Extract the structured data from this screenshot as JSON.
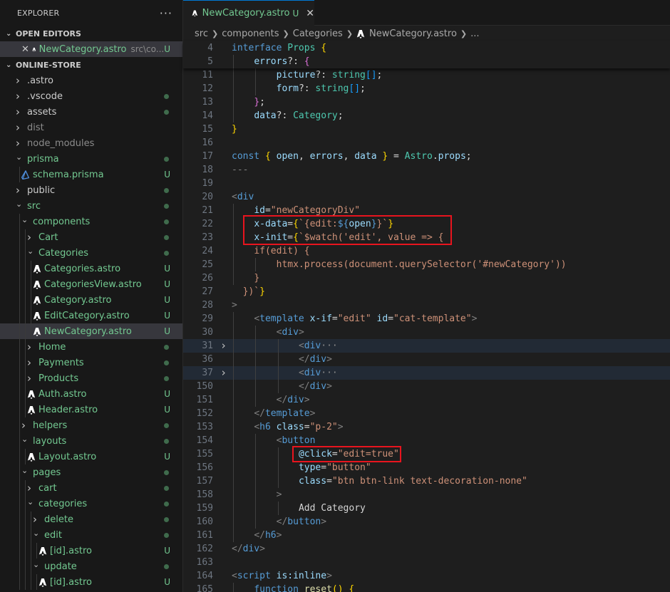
{
  "sidebar": {
    "title": "EXPLORER",
    "more_label": "···",
    "open_editors_title": "OPEN EDITORS",
    "open_editor": {
      "name": "NewCategory.astro",
      "path": "src\\co...",
      "status": "U"
    },
    "project_title": "ONLINE-STORE",
    "tree": [
      {
        "label": ".astro",
        "depth": 0,
        "chev": ">",
        "kind": "folder",
        "color": "norm"
      },
      {
        "label": ".vscode",
        "depth": 0,
        "chev": ">",
        "kind": "folder",
        "color": "norm",
        "dot": true
      },
      {
        "label": "assets",
        "depth": 0,
        "chev": ">",
        "kind": "folder",
        "color": "norm",
        "dot": true
      },
      {
        "label": "dist",
        "depth": 0,
        "chev": ">",
        "kind": "folder",
        "color": "dim"
      },
      {
        "label": "node_modules",
        "depth": 0,
        "chev": ">",
        "kind": "folder",
        "color": "dim"
      },
      {
        "label": "prisma",
        "depth": 0,
        "chev": "v",
        "kind": "folder",
        "color": "git",
        "dot": true
      },
      {
        "label": "schema.prisma",
        "depth": 1,
        "kind": "prisma",
        "color": "git",
        "status": "U"
      },
      {
        "label": "public",
        "depth": 0,
        "chev": ">",
        "kind": "folder",
        "color": "norm",
        "dot": true
      },
      {
        "label": "src",
        "depth": 0,
        "chev": "v",
        "kind": "folder",
        "color": "git",
        "dot": true
      },
      {
        "label": "components",
        "depth": 1,
        "chev": "v",
        "kind": "folder",
        "color": "git",
        "dot": true
      },
      {
        "label": "Cart",
        "depth": 2,
        "chev": ">",
        "kind": "folder",
        "color": "git",
        "dot": true
      },
      {
        "label": "Categories",
        "depth": 2,
        "chev": "v",
        "kind": "folder",
        "color": "git",
        "dot": true
      },
      {
        "label": "Categories.astro",
        "depth": 3,
        "kind": "astro",
        "color": "git",
        "status": "U"
      },
      {
        "label": "CategoriesView.astro",
        "depth": 3,
        "kind": "astro",
        "color": "git",
        "status": "U"
      },
      {
        "label": "Category.astro",
        "depth": 3,
        "kind": "astro",
        "color": "git",
        "status": "U"
      },
      {
        "label": "EditCategory.astro",
        "depth": 3,
        "kind": "astro",
        "color": "git",
        "status": "U"
      },
      {
        "label": "NewCategory.astro",
        "depth": 3,
        "kind": "astro",
        "color": "git",
        "status": "U",
        "selected": true
      },
      {
        "label": "Home",
        "depth": 2,
        "chev": ">",
        "kind": "folder",
        "color": "git",
        "dot": true
      },
      {
        "label": "Payments",
        "depth": 2,
        "chev": ">",
        "kind": "folder",
        "color": "git",
        "dot": true
      },
      {
        "label": "Products",
        "depth": 2,
        "chev": ">",
        "kind": "folder",
        "color": "git",
        "dot": true
      },
      {
        "label": "Auth.astro",
        "depth": 2,
        "kind": "astro",
        "color": "git",
        "status": "U"
      },
      {
        "label": "Header.astro",
        "depth": 2,
        "kind": "astro",
        "color": "git",
        "status": "U"
      },
      {
        "label": "helpers",
        "depth": 1,
        "chev": ">",
        "kind": "folder",
        "color": "git",
        "dot": true
      },
      {
        "label": "layouts",
        "depth": 1,
        "chev": "v",
        "kind": "folder",
        "color": "git",
        "dot": true
      },
      {
        "label": "Layout.astro",
        "depth": 2,
        "kind": "astro",
        "color": "git",
        "status": "U"
      },
      {
        "label": "pages",
        "depth": 1,
        "chev": "v",
        "kind": "folder",
        "color": "git",
        "dot": true
      },
      {
        "label": "cart",
        "depth": 2,
        "chev": ">",
        "kind": "folder",
        "color": "git",
        "dot": true
      },
      {
        "label": "categories",
        "depth": 2,
        "chev": "v",
        "kind": "folder",
        "color": "git",
        "dot": true
      },
      {
        "label": "delete",
        "depth": 3,
        "chev": ">",
        "kind": "folder",
        "color": "git",
        "dot": true
      },
      {
        "label": "edit",
        "depth": 3,
        "chev": "v",
        "kind": "folder",
        "color": "git",
        "dot": true
      },
      {
        "label": "[id].astro",
        "depth": 4,
        "kind": "astro",
        "color": "git",
        "status": "U"
      },
      {
        "label": "update",
        "depth": 3,
        "chev": "v",
        "kind": "folder",
        "color": "git",
        "dot": true
      },
      {
        "label": "[id].astro",
        "depth": 4,
        "kind": "astro",
        "color": "git",
        "status": "U"
      }
    ]
  },
  "tab": {
    "name": "NewCategory.astro",
    "status": "U",
    "close": "✕"
  },
  "breadcrumb": [
    "src",
    "components",
    "Categories",
    "NewCategory.astro",
    "..."
  ],
  "sticky_lines": [
    {
      "n": "4",
      "t": [
        [
          "k",
          "interface "
        ],
        [
          "ty",
          "Props "
        ],
        [
          "br1",
          "{"
        ]
      ]
    },
    {
      "n": "5",
      "t": [
        [
          "g",
          1
        ],
        [
          "v",
          "errors"
        ],
        [
          "p",
          "?: "
        ],
        [
          "br2",
          "{"
        ]
      ]
    }
  ],
  "code_lines": [
    {
      "n": "11",
      "t": [
        [
          "g",
          1
        ],
        [
          "g",
          2
        ],
        [
          "v",
          "picture"
        ],
        [
          "p",
          "?: "
        ],
        [
          "ty",
          "string"
        ],
        [
          "br3",
          "[]"
        ],
        [
          "p",
          ";"
        ]
      ]
    },
    {
      "n": "12",
      "t": [
        [
          "g",
          1
        ],
        [
          "g",
          2
        ],
        [
          "v",
          "form"
        ],
        [
          "p",
          "?: "
        ],
        [
          "ty",
          "string"
        ],
        [
          "br3",
          "[]"
        ],
        [
          "p",
          ";"
        ]
      ]
    },
    {
      "n": "13",
      "t": [
        [
          "g",
          1
        ],
        [
          "br2",
          "}"
        ],
        [
          "p",
          ";"
        ]
      ]
    },
    {
      "n": "14",
      "t": [
        [
          "g",
          1
        ],
        [
          "v",
          "data"
        ],
        [
          "p",
          "?: "
        ],
        [
          "ty",
          "Category"
        ],
        [
          "p",
          ";"
        ]
      ]
    },
    {
      "n": "15",
      "t": [
        [
          "br1",
          "}"
        ]
      ]
    },
    {
      "n": "16",
      "t": []
    },
    {
      "n": "17",
      "t": [
        [
          "k",
          "const "
        ],
        [
          "br1",
          "{ "
        ],
        [
          "v",
          "open"
        ],
        [
          "p",
          ", "
        ],
        [
          "v",
          "errors"
        ],
        [
          "p",
          ", "
        ],
        [
          "v",
          "data "
        ],
        [
          "br1",
          "}"
        ],
        [
          "p",
          " = "
        ],
        [
          "ty",
          "Astro"
        ],
        [
          "p",
          "."
        ],
        [
          "v",
          "props"
        ],
        [
          "p",
          ";"
        ]
      ]
    },
    {
      "n": "18",
      "t": [
        [
          "tg",
          "---"
        ]
      ]
    },
    {
      "n": "19",
      "t": []
    },
    {
      "n": "20",
      "t": [
        [
          "tg",
          "<"
        ],
        [
          "k",
          "div"
        ]
      ]
    },
    {
      "n": "21",
      "t": [
        [
          "g",
          1
        ],
        [
          "v",
          "id"
        ],
        [
          "p",
          "="
        ],
        [
          "s",
          "\"newCategoryDiv\""
        ]
      ]
    },
    {
      "n": "22",
      "t": [
        [
          "g",
          1
        ],
        [
          "v",
          "x-data"
        ],
        [
          "p",
          "="
        ],
        [
          "br1",
          "{"
        ],
        [
          "s",
          "`{edit:"
        ],
        [
          "k",
          "${"
        ],
        [
          "v",
          "open"
        ],
        [
          "k",
          "}"
        ],
        [
          "s",
          "}`"
        ],
        [
          "br1",
          "}"
        ]
      ]
    },
    {
      "n": "23",
      "t": [
        [
          "g",
          1
        ],
        [
          "v",
          "x-init"
        ],
        [
          "p",
          "="
        ],
        [
          "br1",
          "{"
        ],
        [
          "s",
          "`$watch('edit', value => {"
        ]
      ]
    },
    {
      "n": "24",
      "t": [
        [
          "g",
          1
        ],
        [
          "s",
          "if(edit) {"
        ]
      ]
    },
    {
      "n": "25",
      "t": [
        [
          "g",
          1
        ],
        [
          "g",
          2
        ],
        [
          "s",
          "htmx.process(document.querySelector('#newCategory'))"
        ]
      ]
    },
    {
      "n": "26",
      "t": [
        [
          "g",
          1
        ],
        [
          "s",
          "}"
        ]
      ]
    },
    {
      "n": "27",
      "t": [
        [
          "p",
          "  "
        ],
        [
          "s",
          "})`"
        ],
        [
          "br1",
          "}"
        ]
      ]
    },
    {
      "n": "28",
      "t": [
        [
          "tg",
          ">"
        ]
      ]
    },
    {
      "n": "29",
      "t": [
        [
          "g",
          1
        ],
        [
          "tg",
          "<"
        ],
        [
          "k",
          "template "
        ],
        [
          "v",
          "x-if"
        ],
        [
          "p",
          "="
        ],
        [
          "s",
          "\"edit\" "
        ],
        [
          "v",
          "id"
        ],
        [
          "p",
          "="
        ],
        [
          "s",
          "\"cat-template\""
        ],
        [
          "tg",
          ">"
        ]
      ]
    },
    {
      "n": "30",
      "t": [
        [
          "g",
          1
        ],
        [
          "g",
          2
        ],
        [
          "tg",
          "<"
        ],
        [
          "k",
          "div"
        ],
        [
          "tg",
          ">"
        ]
      ]
    },
    {
      "n": "31",
      "fold": ">",
      "hl": true,
      "t": [
        [
          "g",
          1
        ],
        [
          "g",
          2
        ],
        [
          "g",
          3
        ],
        [
          "tg",
          "<"
        ],
        [
          "k",
          "div"
        ],
        [
          "fm",
          "···"
        ]
      ]
    },
    {
      "n": "36",
      "t": [
        [
          "g",
          1
        ],
        [
          "g",
          2
        ],
        [
          "g",
          3
        ],
        [
          "tg",
          "</"
        ],
        [
          "k",
          "div"
        ],
        [
          "tg",
          ">"
        ]
      ]
    },
    {
      "n": "37",
      "fold": ">",
      "hl": true,
      "t": [
        [
          "g",
          1
        ],
        [
          "g",
          2
        ],
        [
          "g",
          3
        ],
        [
          "tg",
          "<"
        ],
        [
          "k",
          "div"
        ],
        [
          "fm",
          "···"
        ]
      ]
    },
    {
      "n": "150",
      "t": [
        [
          "g",
          1
        ],
        [
          "g",
          2
        ],
        [
          "g",
          3
        ],
        [
          "tg",
          "</"
        ],
        [
          "k",
          "div"
        ],
        [
          "tg",
          ">"
        ]
      ]
    },
    {
      "n": "151",
      "t": [
        [
          "g",
          1
        ],
        [
          "g",
          2
        ],
        [
          "tg",
          "</"
        ],
        [
          "k",
          "div"
        ],
        [
          "tg",
          ">"
        ]
      ]
    },
    {
      "n": "152",
      "t": [
        [
          "g",
          1
        ],
        [
          "tg",
          "</"
        ],
        [
          "k",
          "template"
        ],
        [
          "tg",
          ">"
        ]
      ]
    },
    {
      "n": "153",
      "t": [
        [
          "g",
          1
        ],
        [
          "tg",
          "<"
        ],
        [
          "k",
          "h6 "
        ],
        [
          "v",
          "class"
        ],
        [
          "p",
          "="
        ],
        [
          "s",
          "\"p-2\""
        ],
        [
          "tg",
          ">"
        ]
      ]
    },
    {
      "n": "154",
      "t": [
        [
          "g",
          1
        ],
        [
          "g",
          2
        ],
        [
          "tg",
          "<"
        ],
        [
          "k",
          "button"
        ]
      ]
    },
    {
      "n": "155",
      "t": [
        [
          "g",
          1
        ],
        [
          "g",
          2
        ],
        [
          "g",
          3
        ],
        [
          "v",
          "@click"
        ],
        [
          "p",
          "="
        ],
        [
          "s",
          "\"edit=true\""
        ]
      ]
    },
    {
      "n": "156",
      "t": [
        [
          "g",
          1
        ],
        [
          "g",
          2
        ],
        [
          "g",
          3
        ],
        [
          "v",
          "type"
        ],
        [
          "p",
          "="
        ],
        [
          "s",
          "\"button\""
        ]
      ]
    },
    {
      "n": "157",
      "t": [
        [
          "g",
          1
        ],
        [
          "g",
          2
        ],
        [
          "g",
          3
        ],
        [
          "v",
          "class"
        ],
        [
          "p",
          "="
        ],
        [
          "s",
          "\"btn btn-link text-decoration-none\""
        ]
      ]
    },
    {
      "n": "158",
      "t": [
        [
          "g",
          1
        ],
        [
          "g",
          2
        ],
        [
          "tg",
          ">"
        ]
      ]
    },
    {
      "n": "159",
      "t": [
        [
          "g",
          1
        ],
        [
          "g",
          2
        ],
        [
          "g",
          3
        ],
        [
          "p",
          "Add Category"
        ]
      ]
    },
    {
      "n": "160",
      "t": [
        [
          "g",
          1
        ],
        [
          "g",
          2
        ],
        [
          "tg",
          "</"
        ],
        [
          "k",
          "button"
        ],
        [
          "tg",
          ">"
        ]
      ]
    },
    {
      "n": "161",
      "t": [
        [
          "g",
          1
        ],
        [
          "tg",
          "</"
        ],
        [
          "k",
          "h6"
        ],
        [
          "tg",
          ">"
        ]
      ]
    },
    {
      "n": "162",
      "t": [
        [
          "tg",
          "</"
        ],
        [
          "k",
          "div"
        ],
        [
          "tg",
          ">"
        ]
      ]
    },
    {
      "n": "163",
      "t": []
    },
    {
      "n": "164",
      "t": [
        [
          "tg",
          "<"
        ],
        [
          "k",
          "script "
        ],
        [
          "v",
          "is:inline"
        ],
        [
          "tg",
          ">"
        ]
      ]
    },
    {
      "n": "165",
      "t": [
        [
          "g",
          1
        ],
        [
          "k",
          "function "
        ],
        [
          "fn",
          "reset"
        ],
        [
          "br1",
          "() {"
        ]
      ]
    }
  ],
  "colors": {
    "git_untracked": "#73c991",
    "accent": "#0078d4",
    "highlight_box": "#e8141e",
    "astro_icon": "#ffffff",
    "prisma_icon": "#4f8fdc"
  }
}
